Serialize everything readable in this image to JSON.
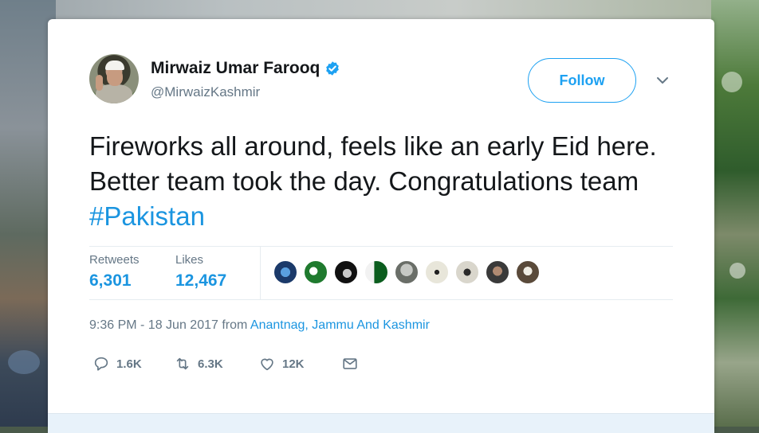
{
  "tweet": {
    "author": {
      "display_name": "Mirwaiz Umar Farooq",
      "handle": "@MirwaizKashmir",
      "verified": true
    },
    "follow_label": "Follow",
    "text_before": "Fireworks all around, feels like an early Eid here. Better team took the day. Congratulations team ",
    "hashtag": "#Pakistan",
    "stats": {
      "retweets_label": "Retweets",
      "retweets_value": "6,301",
      "likes_label": "Likes",
      "likes_value": "12,467"
    },
    "likers_count": 9,
    "timestamp": "9:36 PM - 18 Jun 2017",
    "from_word": "from",
    "location": "Anantnag, Jammu And Kashmir",
    "actions": {
      "reply_count": "1.6K",
      "retweet_count": "6.3K",
      "like_count": "12K"
    }
  },
  "colors": {
    "accent": "#1da1f2",
    "link": "#1b95e0",
    "text": "#14171a",
    "muted": "#657786"
  }
}
